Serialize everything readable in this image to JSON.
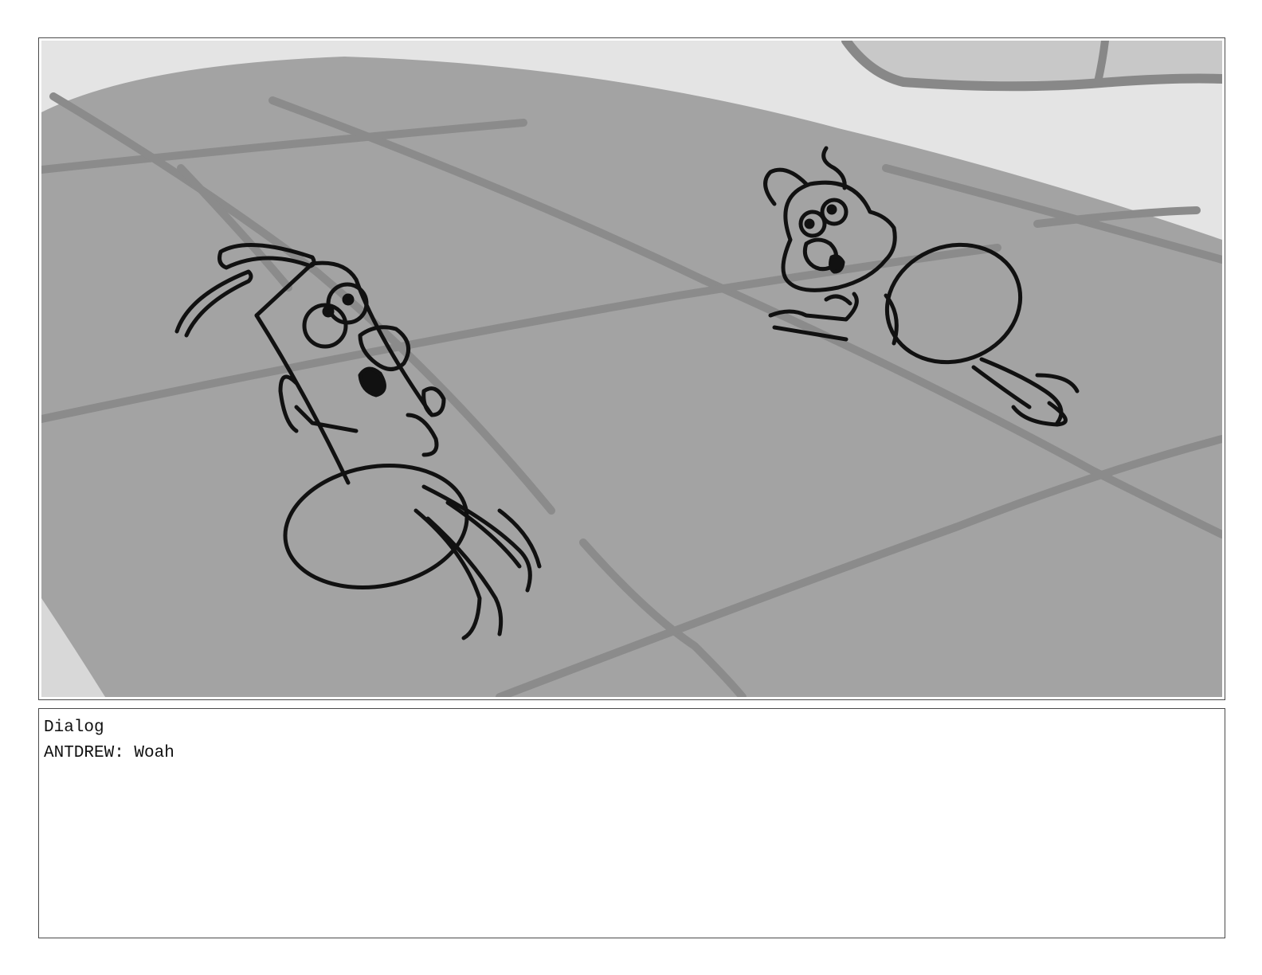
{
  "dialog": {
    "heading": "Dialog",
    "line": "ANTDREW: Woah"
  },
  "colors": {
    "floor": "#a3a3a3",
    "floor_lines": "#8b8b8b",
    "background": "#e4e4e4",
    "ink": "#111111",
    "frame_border": "#4a4a4a"
  }
}
